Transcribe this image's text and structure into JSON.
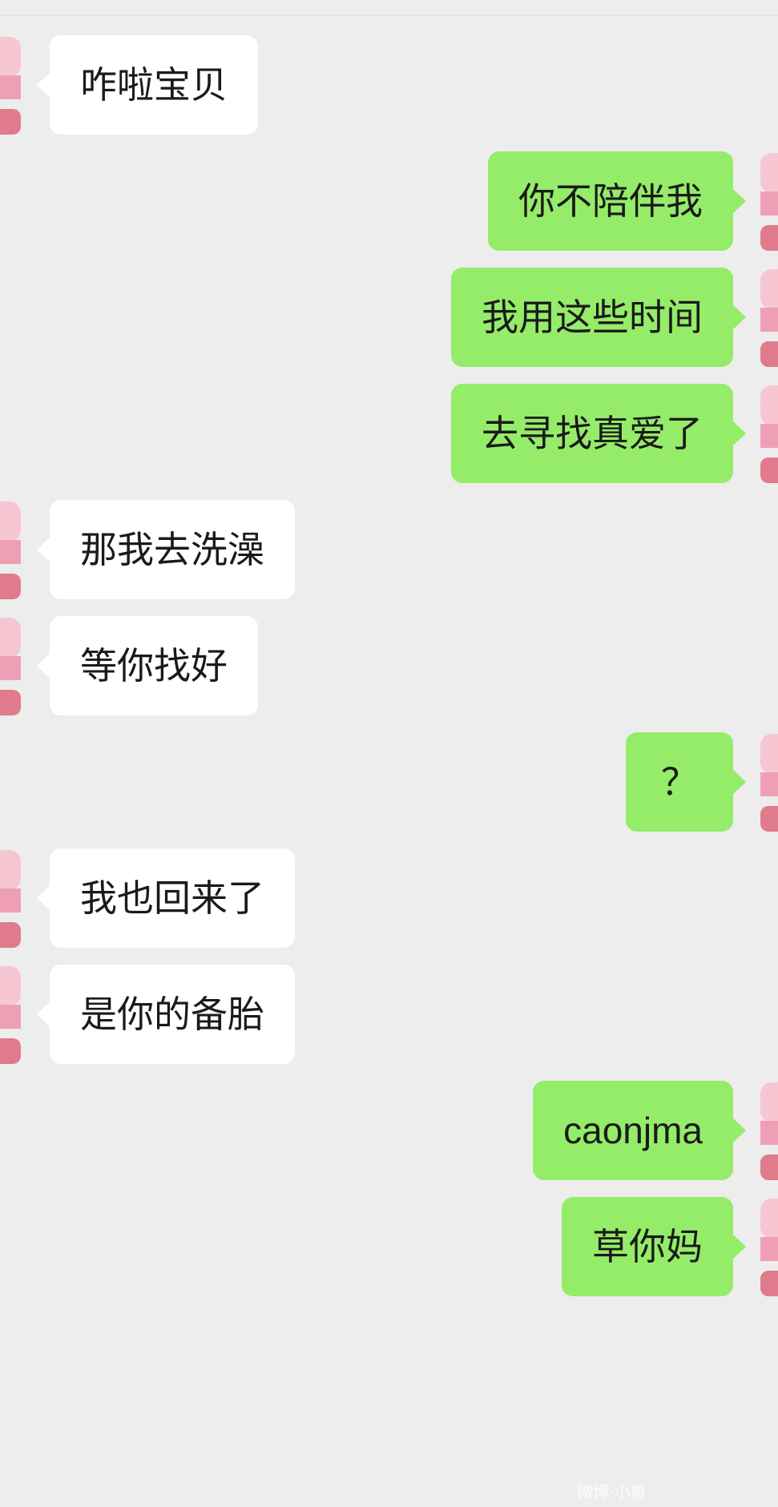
{
  "chat": {
    "messages": [
      {
        "side": "in",
        "text": "咋啦宝贝"
      },
      {
        "side": "out",
        "text": "你不陪伴我"
      },
      {
        "side": "out",
        "text": "我用这些时间"
      },
      {
        "side": "out",
        "text": "去寻找真爱了"
      },
      {
        "side": "in",
        "text": "那我去洗澡"
      },
      {
        "side": "in",
        "text": "等你找好"
      },
      {
        "side": "out",
        "text": "？"
      },
      {
        "side": "in",
        "text": "我也回来了"
      },
      {
        "side": "in",
        "text": "是你的备胎"
      },
      {
        "side": "out",
        "text": "caonjma"
      },
      {
        "side": "out",
        "text": "草你妈"
      }
    ]
  },
  "watermark": {
    "text": "微博·小崽"
  },
  "colors": {
    "background": "#ededed",
    "incoming_bubble": "#ffffff",
    "outgoing_bubble": "#95ec69",
    "text": "#1a1a1a"
  }
}
